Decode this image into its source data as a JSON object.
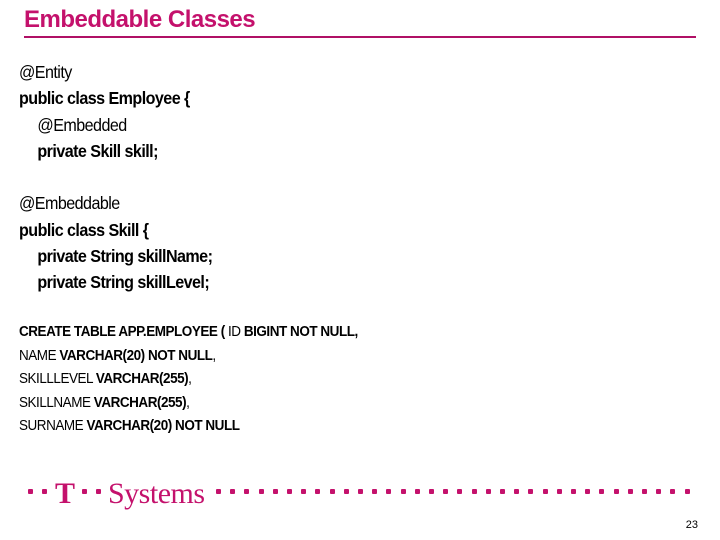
{
  "slide": {
    "title": "Embeddable Classes",
    "accent_color": "#c4116c",
    "page_number": "23"
  },
  "code_block": {
    "lines": [
      {
        "segments": [
          {
            "text": "@Entity",
            "bold": false
          }
        ],
        "indent": false
      },
      {
        "segments": [
          {
            "text": "public class Employee {",
            "bold": true
          }
        ],
        "indent": false
      },
      {
        "segments": [
          {
            "text": "@Embedded",
            "bold": false
          }
        ],
        "indent": true
      },
      {
        "segments": [
          {
            "text": "private Skill skill;",
            "bold": true
          }
        ],
        "indent": true
      },
      {
        "segments": [
          {
            "text": "",
            "bold": false
          }
        ],
        "indent": false
      },
      {
        "segments": [
          {
            "text": "@Embeddable",
            "bold": false
          }
        ],
        "indent": false
      },
      {
        "segments": [
          {
            "text": "public class Skill {",
            "bold": true
          }
        ],
        "indent": false
      },
      {
        "segments": [
          {
            "text": "private String skillName;",
            "bold": true
          }
        ],
        "indent": true
      },
      {
        "segments": [
          {
            "text": "private String skillLevel;",
            "bold": true
          }
        ],
        "indent": true
      }
    ]
  },
  "sql_block": {
    "lines": [
      [
        {
          "text": "CREATE TABLE APP.EMPLOYEE ( ",
          "bold": true
        },
        {
          "text": "ID ",
          "bold": false
        },
        {
          "text": "BIGINT NOT NULL,",
          "bold": true
        }
      ],
      [
        {
          "text": "NAME ",
          "bold": false
        },
        {
          "text": "VARCHAR(20) NOT NULL",
          "bold": true
        },
        {
          "text": ",",
          "bold": false
        }
      ],
      [
        {
          "text": "SKILLLEVEL ",
          "bold": false
        },
        {
          "text": "VARCHAR(255)",
          "bold": true
        },
        {
          "text": ",",
          "bold": false
        }
      ],
      [
        {
          "text": "SKILLNAME ",
          "bold": false
        },
        {
          "text": "VARCHAR(255)",
          "bold": true
        },
        {
          "text": ",",
          "bold": false
        }
      ],
      [
        {
          "text": "SURNAME ",
          "bold": false
        },
        {
          "text": "VARCHAR(20) NOT NULL",
          "bold": true
        }
      ]
    ]
  },
  "footer": {
    "logo_text": "Systems",
    "logo_letter": "T",
    "logo_color": "#c4116c"
  }
}
